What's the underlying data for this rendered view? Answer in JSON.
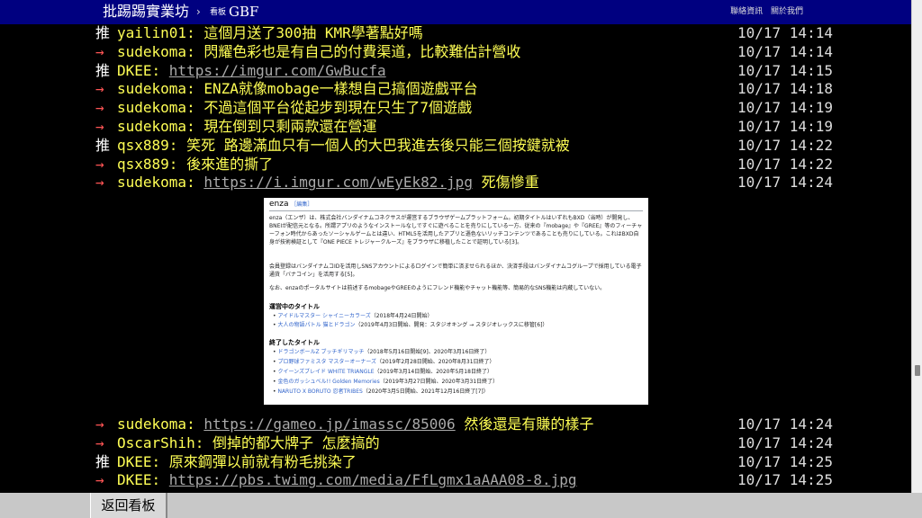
{
  "header": {
    "logo": "批踢踢實業坊",
    "separator": "›",
    "board_keyword": "看板",
    "board_name": "GBF",
    "links": [
      "聯絡資訊",
      "關於我們"
    ]
  },
  "comments": [
    {
      "tag": "推",
      "user": "yailin01",
      "text": ": 這個月送了300抽 KMR學著點好嗎",
      "time": "10/17 14:14"
    },
    {
      "tag": "→",
      "user": "sudekoma",
      "text": ": 閃耀色彩也是有自己的付費渠道，比較難估計營收",
      "time": "10/17 14:14"
    },
    {
      "tag": "推",
      "user": "DKEE",
      "text": ": ",
      "link": "https://imgur.com/GwBucfa",
      "time": "10/17 14:15"
    },
    {
      "tag": "→",
      "user": "sudekoma",
      "text": ": ENZA就像mobage一樣想自己搞個遊戲平台",
      "time": "10/17 14:18"
    },
    {
      "tag": "→",
      "user": "sudekoma",
      "text": ": 不過這個平台從起步到現在只生了7個遊戲",
      "time": "10/17 14:19"
    },
    {
      "tag": "→",
      "user": "sudekoma",
      "text": ": 現在倒到只剩兩款還在營運",
      "time": "10/17 14:19"
    },
    {
      "tag": "推",
      "user": "qsx889",
      "text": ": 笑死 路邊滿血只有一個人的大巴我進去後只能三個按鍵就被",
      "time": "10/17 14:22"
    },
    {
      "tag": "→",
      "user": "qsx889",
      "text": ": 後來進的撕了",
      "time": "10/17 14:22"
    },
    {
      "tag": "→",
      "user": "sudekoma",
      "text": ": ",
      "link": "https://i.imgur.com/wEyEk82.jpg",
      "suffix": " 死傷慘重",
      "time": "10/17 14:24"
    }
  ],
  "comments_after": [
    {
      "tag": "→",
      "user": "sudekoma",
      "text": ": ",
      "link": "https://gameo.jp/imassc/85006",
      "suffix": " 然後還是有賺的樣子",
      "time": "10/17 14:24"
    },
    {
      "tag": "→",
      "user": "OscarShih",
      "text": ": 倒掉的都大牌子 怎麼搞的",
      "time": "10/17 14:24"
    },
    {
      "tag": "推",
      "user": "DKEE",
      "text": ": 原來鋼彈以前就有粉毛挑染了",
      "time": "10/17 14:25"
    },
    {
      "tag": "→",
      "user": "DKEE",
      "text": ": ",
      "link": "https://pbs.twimg.com/media/FfLgmx1aAAA08-8.jpg",
      "time": "10/17 14:25"
    }
  ],
  "embedded_image": {
    "title": "enza",
    "edit": "［編集］",
    "para1": "enza（エンザ）は、株式会社バンダイナムコネクサスが運営するブラウザゲームプラットフォーム。初期タイトルはいずれもBXD（当時）が開発し、BNEIが配信元となる。所謂アプリのようなインストールなしですぐに遊べることを売りにしている一方、従来の『mobage』や『GREE』等のフィーチャーフォン時代からあったソーシャルゲームとは違い、HTML5を活用したアプリと遜色ないリッチコンテンツであることも売りにしている。これはBXD自身が技術検証として『ONE PIECE トレジャークルーズ』をブラウザに移植したことで証明している[3]。",
    "para2": "会員登録はバンダイナムコIDを活用しSNSアカウントによるログインで簡単に済ませられるほか、決済手段はバンダイナムコグループで採用している電子通貨「バナコイン」を活用する[5]。",
    "para3": "なお、enzaのポータルサイトは前述するmobageやGREEのようにフレンド機能やチャット機能等、簡易的なSNS機能は内蔵していない。",
    "section1": "運営中のタイトル",
    "running": [
      {
        "name": "アイドルマスター シャイニーカラーズ",
        "note": "（2018年4月24日開始）"
      },
      {
        "name": "大人の物語パトル 猫とドラゴン",
        "note": "（2019年4月3日開始、開発：スタジオキング → スタジオレックスに移管[6]）"
      }
    ],
    "section2": "終了したタイトル",
    "ended": [
      {
        "name": "ドラゴンボールZ ブッチギリマッチ",
        "note": "（2018年5月16日開始[9]、2020年3月16日終了）"
      },
      {
        "name": "プロ野球ファミスタ マスターオーナーズ",
        "note": "（2019年2月28日開始、2020年8月31日終了）"
      },
      {
        "name": "クイーンズブレイド WHITE TRIANGLE",
        "note": "（2019年3月14日開始、2020年5月18日終了）"
      },
      {
        "name": "金色のガッシュベル!! Golden Memories",
        "note": "（2019年3月27日開始、2020年3月31日終了）"
      },
      {
        "name": "NARUTO X BORUTO 忍者TRIBES",
        "note": "（2020年3月5日開始、2021年12月16日終了[7]）"
      }
    ]
  },
  "footer": {
    "back_label": "返回看板"
  },
  "colors": {
    "topbar": "#000080",
    "push_text": "#ffff55",
    "arrow": "#ff5555",
    "timestamp": "#dddddd",
    "link": "#aaaaaa"
  }
}
